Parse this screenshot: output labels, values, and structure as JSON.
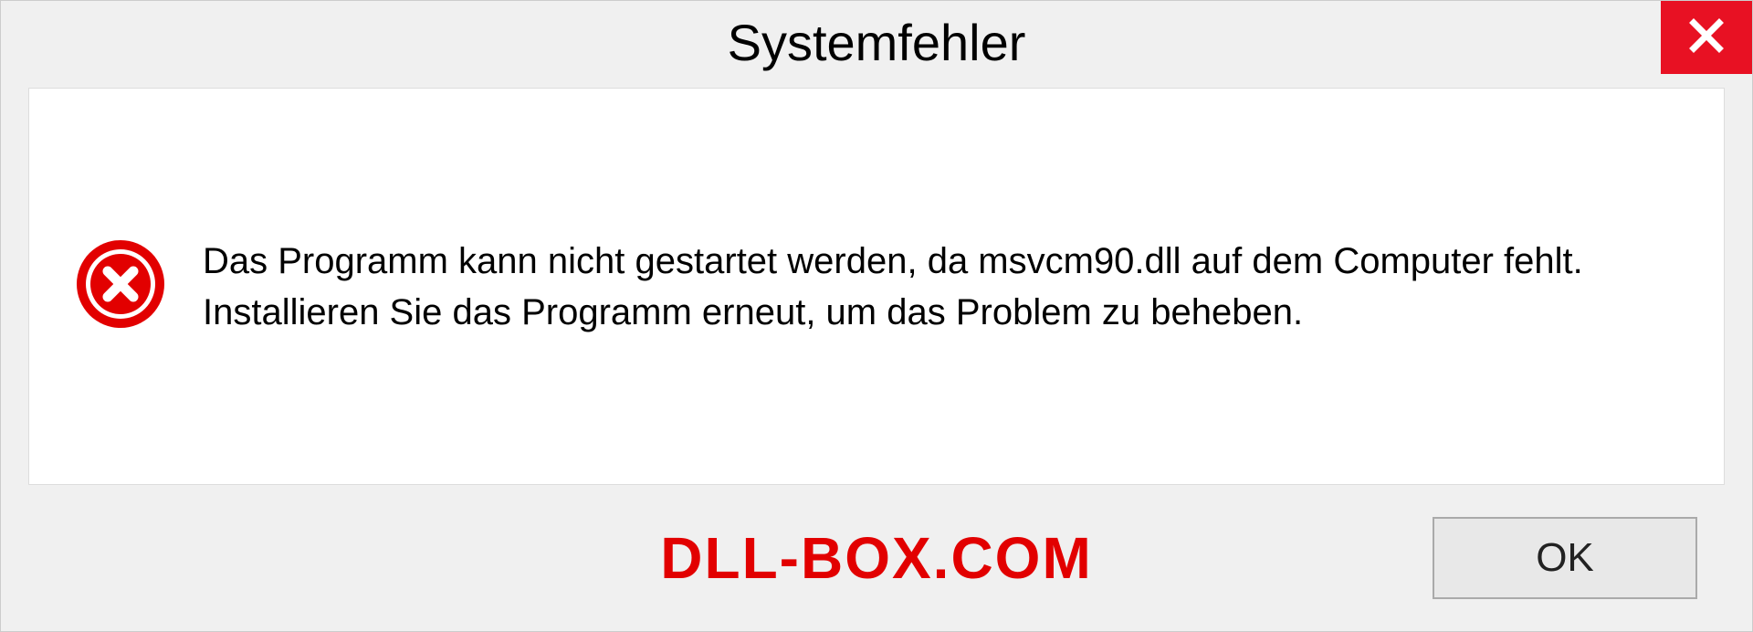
{
  "dialog": {
    "title": "Systemfehler",
    "message": "Das Programm kann nicht gestartet werden, da msvcm90.dll auf dem Computer fehlt. Installieren Sie das Programm erneut, um das Problem zu beheben.",
    "ok_label": "OK"
  },
  "watermark": "DLL-BOX.COM"
}
